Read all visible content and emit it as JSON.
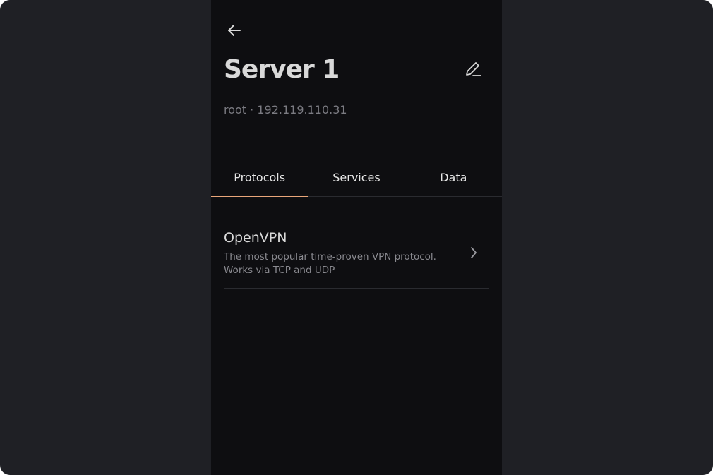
{
  "header": {
    "back_icon": "arrow-left-icon",
    "title": "Server 1",
    "edit_icon": "pencil-icon",
    "subtitle": "root · 192.119.110.31"
  },
  "tabs": [
    {
      "label": "Protocols",
      "active": true
    },
    {
      "label": "Services",
      "active": false
    },
    {
      "label": "Data",
      "active": false
    }
  ],
  "protocols": [
    {
      "name": "OpenVPN",
      "description": "The most popular time-proven VPN protocol. Works via TCP and UDP",
      "icon": "chevron-right-icon"
    }
  ],
  "colors": {
    "background": "#1f2025",
    "panel": "#0e0e11",
    "accent": "#e9a67a",
    "text_primary": "#d9d9d9",
    "text_secondary": "#7b7b82"
  }
}
